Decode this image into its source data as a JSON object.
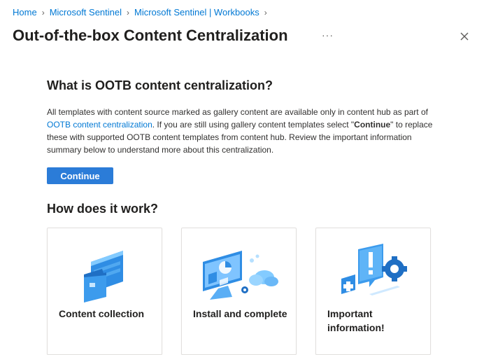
{
  "breadcrumb": {
    "items": [
      "Home",
      "Microsoft Sentinel",
      "Microsoft Sentinel | Workbooks"
    ]
  },
  "page": {
    "title": "Out-of-the-box Content Centralization",
    "more_label": "···"
  },
  "section1": {
    "heading": "What is OOTB content centralization?",
    "desc_part1": "All templates with content source marked as gallery content are available only in content hub as part of ",
    "desc_link": "OOTB content centralization",
    "desc_part2": ". If you are still using gallery content templates select \"",
    "desc_bold": "Continue",
    "desc_part3": "\" to replace these with supported OOTB content templates from content hub. Review the important information summary below to understand more about this centralization."
  },
  "continue_button": {
    "label": "Continue"
  },
  "section2": {
    "heading": "How does it work?"
  },
  "cards": [
    {
      "label": "Content collection",
      "icon": "content-collection-icon"
    },
    {
      "label": "Install and complete",
      "icon": "install-complete-icon"
    },
    {
      "label": "Important information!",
      "icon": "important-information-icon"
    }
  ],
  "colors": {
    "accent": "#2b7cd8",
    "link": "#0078d4"
  }
}
